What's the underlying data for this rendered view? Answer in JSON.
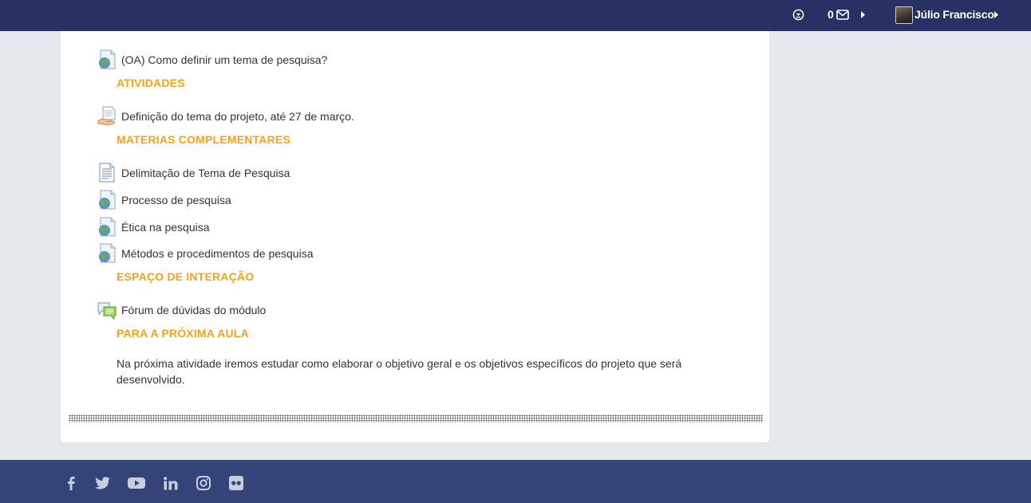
{
  "header": {
    "message_count": "0",
    "user_name": "Júlio Francisco",
    "icons": [
      "help-circle-icon",
      "envelope-icon",
      "caret-right-icon",
      "avatar",
      "caret-right-icon"
    ]
  },
  "content": {
    "items": [
      {
        "label": "(OA) Como definir um tema de pesquisa?",
        "icon": "url-globe-icon"
      },
      {
        "label": "Definição do tema do projeto, até 27 de março.",
        "icon": "assignment-hand-icon"
      },
      {
        "label": "Delimitação de Tema de Pesquisa",
        "icon": "page-document-icon"
      },
      {
        "label": "Processo de pesquisa",
        "icon": "url-globe-icon"
      },
      {
        "label": "Ética na pesquisa",
        "icon": "url-globe-icon"
      },
      {
        "label": "Métodos e procedimentos de pesquisa",
        "icon": "url-globe-icon"
      },
      {
        "label": "Fórum de dúvidas do módulo",
        "icon": "forum-chat-icon"
      }
    ],
    "sections": [
      {
        "title": "ATIVIDADES"
      },
      {
        "title": "MATERIAS COMPLEMENTARES"
      },
      {
        "title": "ESPAÇO DE INTERAÇÃO"
      },
      {
        "title": "PARA A PRÓXIMA AULA"
      }
    ],
    "next_class_text": " Na próxima atividade iremos estudar como elaborar o objetivo geral e os objetivos específicos do projeto que será desenvolvido."
  },
  "footer": {
    "social_icons": [
      "facebook-icon",
      "twitter-icon",
      "youtube-icon",
      "linkedin-icon",
      "instagram-icon",
      "flickr-icon"
    ]
  },
  "colors": {
    "topbar": "#283064",
    "footer": "#354478",
    "section_title": "#f7a21b",
    "background": "#e5e9ed"
  }
}
